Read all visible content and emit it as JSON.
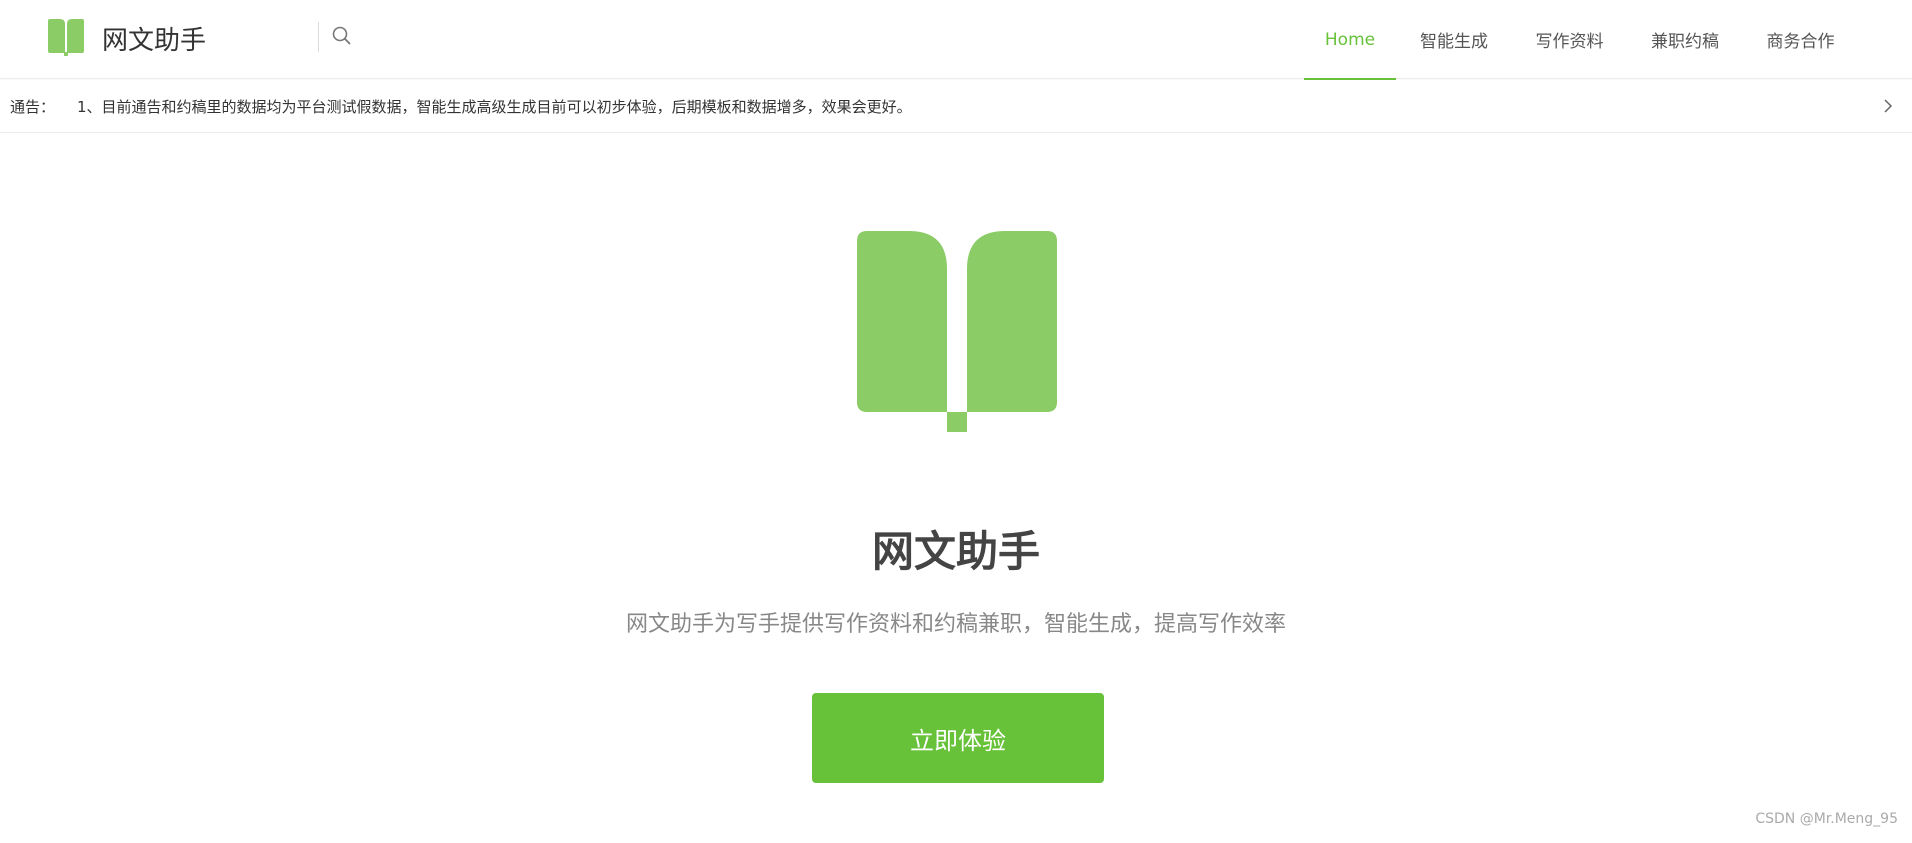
{
  "header": {
    "brand_name": "网文助手",
    "logo_icon": "open-book-icon",
    "search_icon": "search-icon",
    "nav": [
      {
        "label": "Home",
        "active": true
      },
      {
        "label": "智能生成",
        "active": false
      },
      {
        "label": "写作资料",
        "active": false
      },
      {
        "label": "兼职约稿",
        "active": false
      },
      {
        "label": "商务合作",
        "active": false
      }
    ]
  },
  "notice": {
    "label": "通告：",
    "text": "1、目前通告和约稿里的数据均为平台测试假数据，智能生成高级生成目前可以初步体验，后期模板和数据增多，效果会更好。",
    "arrow_icon": "chevron-right-icon"
  },
  "hero": {
    "logo_icon": "open-book-icon",
    "title": "网文助手",
    "subtitle": "网文助手为写手提供写作资料和约稿兼职，智能生成，提高写作效率",
    "cta_label": "立即体验"
  },
  "watermark": "CSDN @Mr.Meng_95",
  "colors": {
    "accent": "#67c23a",
    "logo_green": "#8bcc66",
    "title": "#444444",
    "subtitle": "#888888"
  }
}
